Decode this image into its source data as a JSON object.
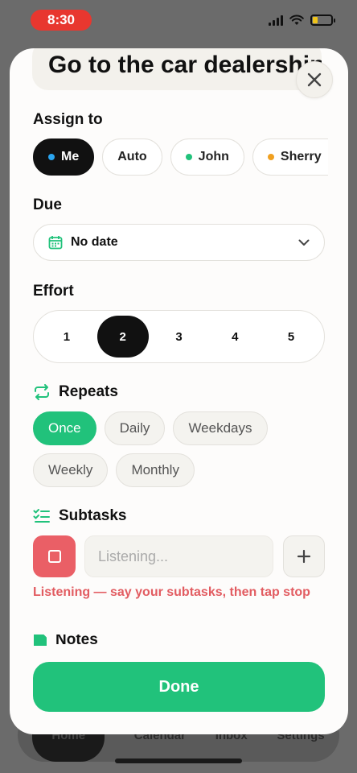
{
  "status_bar": {
    "time": "8:30",
    "battery_level": 0.25
  },
  "task_title": "Go to the car dealership",
  "assign": {
    "label": "Assign to",
    "options": [
      {
        "label": "Me",
        "dot_color": "#2aa5f0",
        "selected": true
      },
      {
        "label": "Auto",
        "dot_color": null,
        "selected": false
      },
      {
        "label": "John",
        "dot_color": "#21c27b",
        "selected": false
      },
      {
        "label": "Sherry",
        "dot_color": "#f0a020",
        "selected": false
      }
    ]
  },
  "due": {
    "label": "Due",
    "value": "No date"
  },
  "effort": {
    "label": "Effort",
    "levels": [
      "1",
      "2",
      "3",
      "4",
      "5"
    ],
    "selected": "2"
  },
  "repeats": {
    "label": "Repeats",
    "options": [
      "Once",
      "Daily",
      "Weekdays",
      "Weekly",
      "Monthly"
    ],
    "selected": "Once"
  },
  "subtasks": {
    "label": "Subtasks",
    "placeholder": "Listening...",
    "listening_message": "Listening — say your subtasks, then tap stop"
  },
  "notes": {
    "label": "Notes"
  },
  "done_label": "Done",
  "background_tabs": [
    "Home",
    "Calendar",
    "Inbox",
    "Settings"
  ],
  "colors": {
    "accent": "#21c27b",
    "danger": "#ea5f66",
    "dark": "#111111"
  }
}
